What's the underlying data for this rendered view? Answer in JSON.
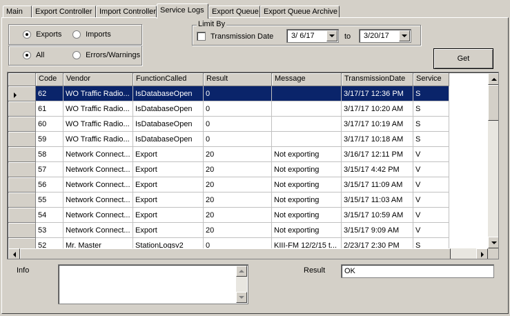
{
  "tabs": [
    {
      "label": "Main"
    },
    {
      "label": "Export Controller"
    },
    {
      "label": "Import Controller"
    },
    {
      "label": "Service Logs",
      "active": true
    },
    {
      "label": "Export Queue"
    },
    {
      "label": "Export Queue Archive"
    }
  ],
  "direction": {
    "exports_label": "Exports",
    "imports_label": "Imports",
    "selected": "Exports"
  },
  "filter": {
    "all_label": "All",
    "errors_label": "Errors/Warnings",
    "selected": "All"
  },
  "limit_by": {
    "legend": "Limit By",
    "transmission_date_label": "Transmission Date",
    "checked": false,
    "from_date": "3/  6/17",
    "to_label": "to",
    "to_date": "3/20/17"
  },
  "get_button_label": "Get",
  "grid": {
    "columns": [
      "Code",
      "Vendor",
      "FunctionCalled",
      "Result",
      "Message",
      "TransmissionDate",
      "Service"
    ],
    "rows": [
      [
        "62",
        "WO Traffic Radio...",
        "IsDatabaseOpen",
        "0",
        "",
        "3/17/17 12:36 PM",
        "S"
      ],
      [
        "61",
        "WO Traffic Radio...",
        "IsDatabaseOpen",
        "0",
        "",
        "3/17/17 10:20 AM",
        "S"
      ],
      [
        "60",
        "WO Traffic Radio...",
        "IsDatabaseOpen",
        "0",
        "",
        "3/17/17 10:19 AM",
        "S"
      ],
      [
        "59",
        "WO Traffic Radio...",
        "IsDatabaseOpen",
        "0",
        "",
        "3/17/17 10:18 AM",
        "S"
      ],
      [
        "58",
        "Network Connect...",
        "Export",
        "20",
        "Not exporting",
        "3/16/17 12:11 PM",
        "V"
      ],
      [
        "57",
        "Network Connect...",
        "Export",
        "20",
        "Not exporting",
        "3/15/17 4:42 PM",
        "V"
      ],
      [
        "56",
        "Network Connect...",
        "Export",
        "20",
        "Not exporting",
        "3/15/17 11:09 AM",
        "V"
      ],
      [
        "55",
        "Network Connect...",
        "Export",
        "20",
        "Not exporting",
        "3/15/17 11:03 AM",
        "V"
      ],
      [
        "54",
        "Network Connect...",
        "Export",
        "20",
        "Not exporting",
        "3/15/17 10:59 AM",
        "V"
      ],
      [
        "53",
        "Network Connect...",
        "Export",
        "20",
        "Not exporting",
        "3/15/17 9:09 AM",
        "V"
      ],
      [
        "52",
        "Mr. Master",
        "StationLogsv2",
        "0",
        "KIII-FM 12/2/15 t...",
        "2/23/17 2:30 PM",
        "S"
      ]
    ],
    "selected_row_index": 0
  },
  "info": {
    "label": "Info",
    "value": ""
  },
  "result": {
    "label": "Result",
    "value": "OK"
  },
  "colors": {
    "selection": "#0a246a",
    "face": "#d4d0c8"
  }
}
